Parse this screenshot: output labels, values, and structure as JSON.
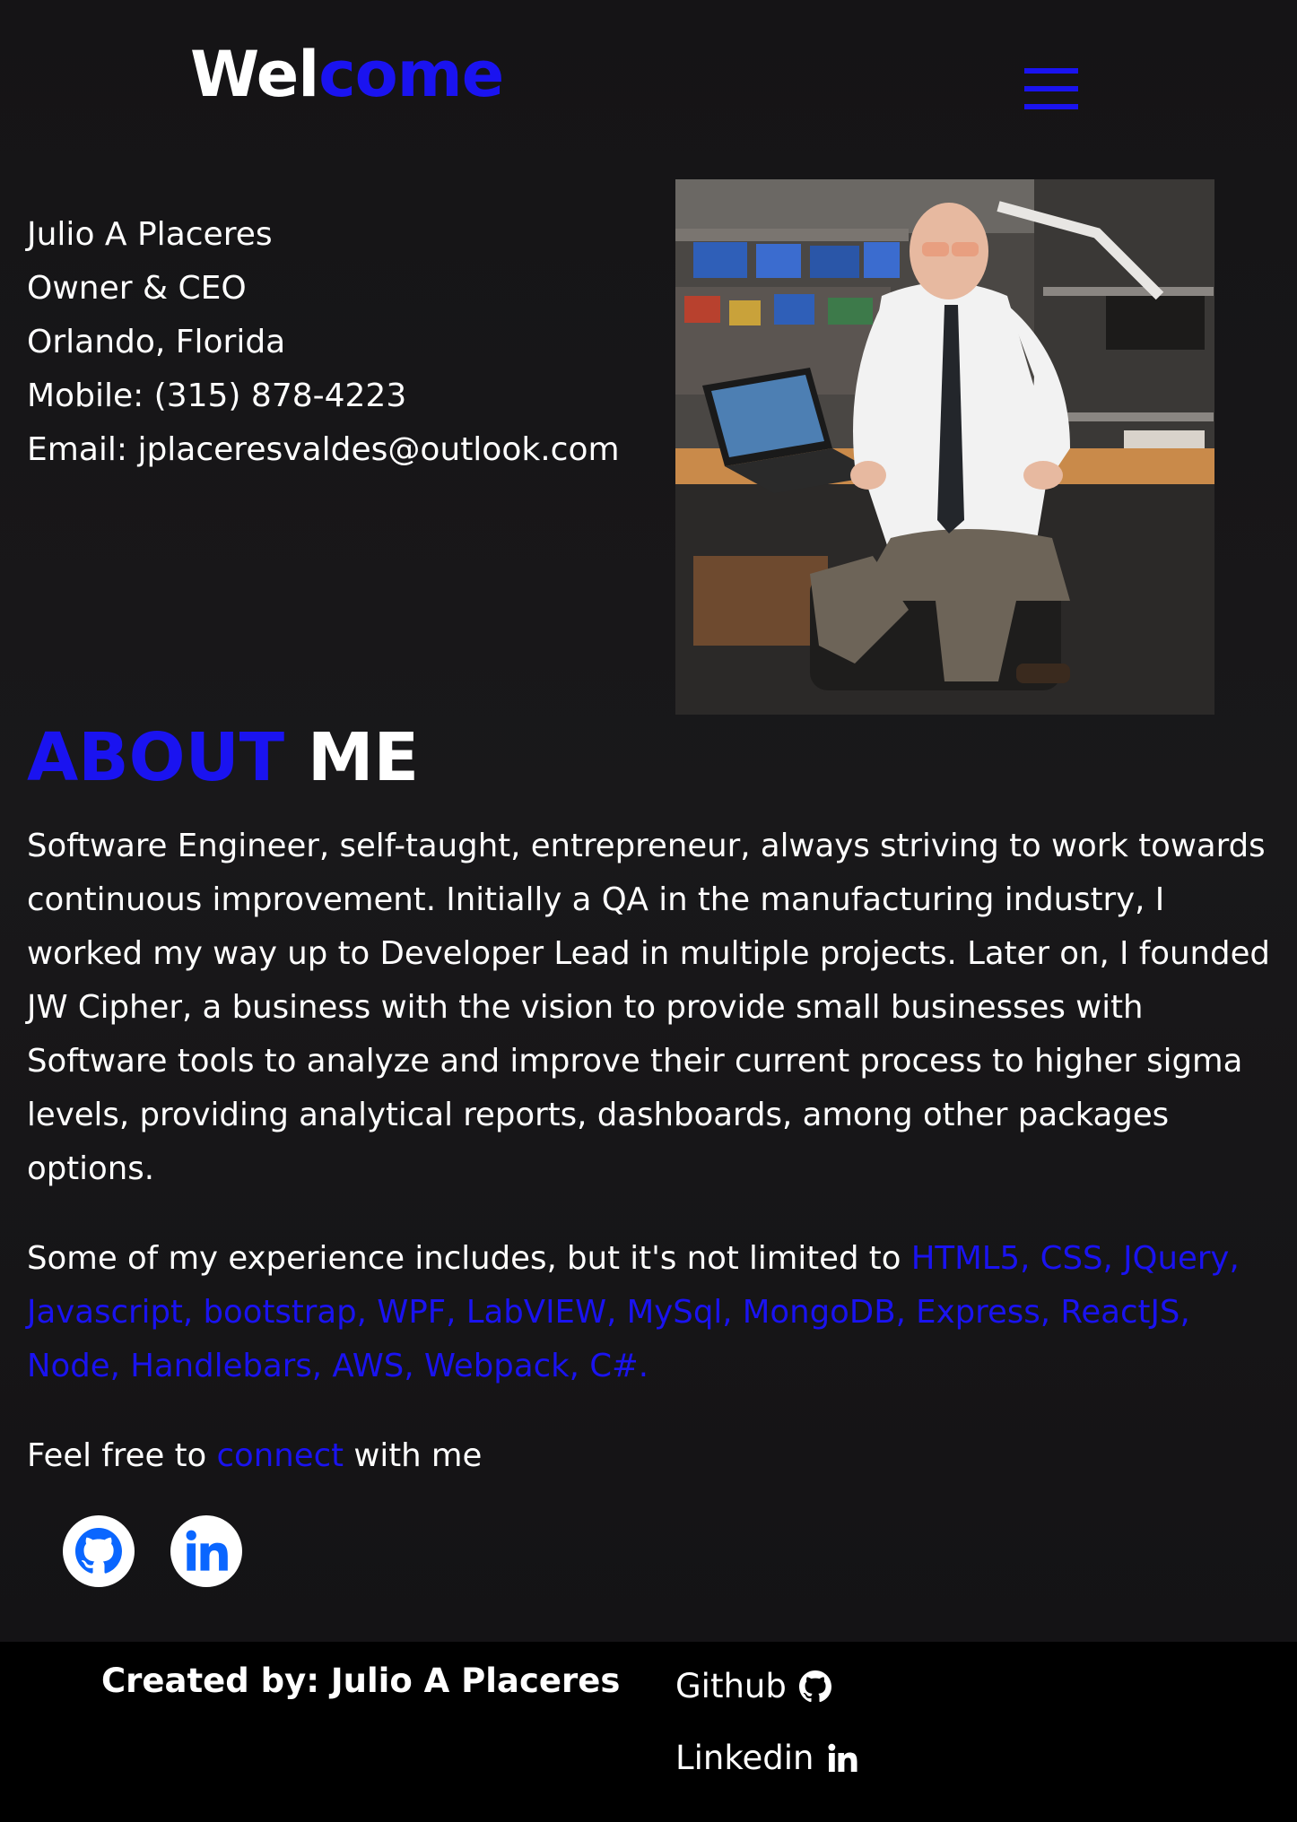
{
  "header": {
    "brand_part1": "Wel",
    "brand_part2": "come",
    "menu_icon": "hamburger-menu-icon"
  },
  "contact": {
    "name": "Julio A Placeres",
    "title": "Owner & CEO",
    "location": "Orlando, Florida",
    "mobile": "Mobile: (315) 878-4223",
    "email": "Email: jplaceresvaldes@outlook.com"
  },
  "photo": {
    "alt": "Portrait photo of Julio A Placeres sitting at an electronics workbench"
  },
  "about": {
    "title_part1": "ABOUT",
    "title_part2": "ME",
    "paragraph": "Software Engineer, self-taught, entrepreneur, always striving to work towards continuous improvement. Initially a QA in the manufacturing industry, I worked my way up to Developer Lead in multiple projects. Later on, I founded JW Cipher, a business with the vision to provide small businesses with Software tools to analyze and improve their current process to higher sigma levels, providing analytical reports, dashboards, among other packages options.",
    "experience_prefix": "Some of my experience includes, but it's not limited to ",
    "experience_skills": "HTML5, CSS, JQuery, Javascript, bootstrap, WPF, LabVIEW, MySql, MongoDB, Express, ReactJS, Node, Handlebars, AWS, Webpack, C#.",
    "connect_prefix": "Feel free to ",
    "connect_link": "connect",
    "connect_suffix": " with me"
  },
  "social": {
    "github_icon": "github-icon",
    "linkedin_icon": "linkedin-icon"
  },
  "footer": {
    "credit": "Created by: Julio A Placeres",
    "github_label": "Github",
    "linkedin_label": "Linkedin"
  },
  "colors": {
    "accent": "#1a13f0",
    "background": "#151416",
    "footer_bg": "#000000",
    "social_icon": "#0a66ff"
  }
}
